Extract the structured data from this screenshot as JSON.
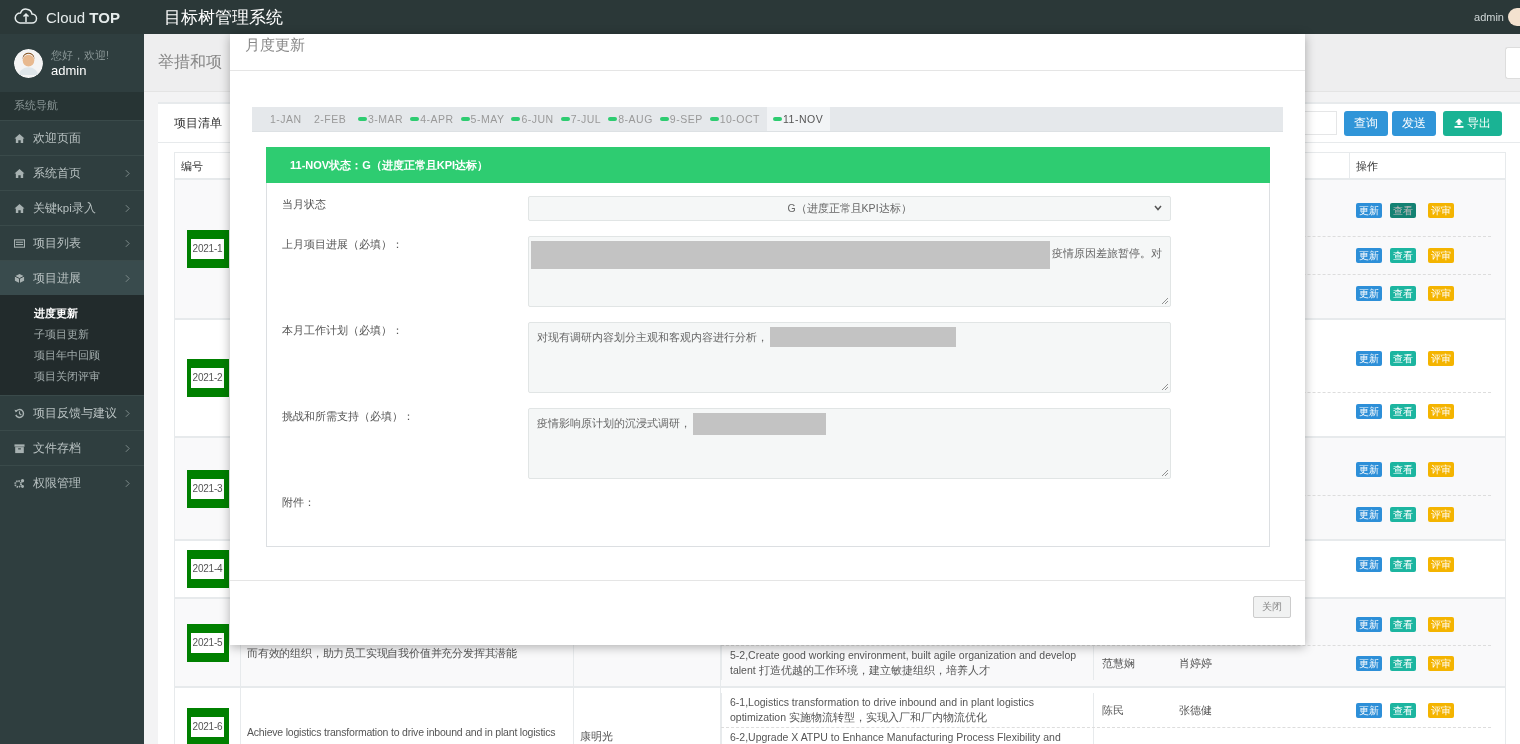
{
  "header": {
    "brand": "Cloud **TOP**",
    "title": "目标树管理系统",
    "user": "admin"
  },
  "sidebar": {
    "greeting": "您好，欢迎!",
    "username": "admin",
    "section_title": "系统导航",
    "items": [
      {
        "label": "欢迎页面",
        "expandable": false,
        "expanded": false
      },
      {
        "label": "系统首页",
        "expandable": true,
        "expanded": false
      },
      {
        "label": "关键kpi录入",
        "expandable": true,
        "expanded": false
      },
      {
        "label": "项目列表",
        "expandable": true,
        "expanded": false
      },
      {
        "label": "项目进展",
        "expandable": true,
        "expanded": true,
        "children": [
          {
            "label": "进度更新",
            "selected": true
          },
          {
            "label": "子项目更新",
            "selected": false
          },
          {
            "label": "项目年中回顾",
            "selected": false
          },
          {
            "label": "项目关闭评审",
            "selected": false
          }
        ]
      },
      {
        "label": "项目反馈与建议",
        "expandable": true,
        "expanded": false
      },
      {
        "label": "文件存档",
        "expandable": true,
        "expanded": false
      },
      {
        "label": "权限管理",
        "expandable": true,
        "expanded": false
      }
    ]
  },
  "page": {
    "title": "举措和项"
  },
  "card": {
    "title": "项目清单",
    "buttons": [
      {
        "label": "查询",
        "kind": "primary"
      },
      {
        "label": "发送",
        "kind": "primary"
      },
      {
        "label": "导出",
        "kind": "export"
      }
    ]
  },
  "table": {
    "id_header": "编号",
    "actions_header": "操作",
    "rows": [
      {
        "id": "2021-1",
        "subrows": [
          {
            "actions": [
              {
                "label": "更新",
                "kind": "update",
                "hovered": false
              },
              {
                "label": "查看",
                "kind": "view",
                "hovered": true
              },
              {
                "label": "评审",
                "kind": "review",
                "hovered": false
              }
            ]
          },
          {
            "actions": [
              {
                "label": "更新",
                "kind": "update",
                "hovered": false
              },
              {
                "label": "查看",
                "kind": "view",
                "hovered": false
              },
              {
                "label": "评审",
                "kind": "review",
                "hovered": false
              }
            ]
          },
          {
            "actions": [
              {
                "label": "更新",
                "kind": "update",
                "hovered": false
              },
              {
                "label": "查看",
                "kind": "view",
                "hovered": false
              },
              {
                "label": "评审",
                "kind": "review",
                "hovered": false
              }
            ]
          }
        ]
      },
      {
        "id": "2021-2",
        "subrows": [
          {
            "actions": [
              {
                "label": "更新",
                "kind": "update",
                "hovered": false
              },
              {
                "label": "查看",
                "kind": "view",
                "hovered": false
              },
              {
                "label": "评审",
                "kind": "review",
                "hovered": false
              }
            ]
          },
          {
            "actions": [
              {
                "label": "更新",
                "kind": "update",
                "hovered": false
              },
              {
                "label": "查看",
                "kind": "view",
                "hovered": false
              },
              {
                "label": "评审",
                "kind": "review",
                "hovered": false
              }
            ]
          }
        ]
      },
      {
        "id": "2021-3",
        "subrows": [
          {
            "actions": [
              {
                "label": "更新",
                "kind": "update",
                "hovered": false
              },
              {
                "label": "查看",
                "kind": "view",
                "hovered": false
              },
              {
                "label": "评审",
                "kind": "review",
                "hovered": false
              }
            ]
          },
          {
            "actions": [
              {
                "label": "更新",
                "kind": "update",
                "hovered": false
              },
              {
                "label": "查看",
                "kind": "view",
                "hovered": false
              },
              {
                "label": "评审",
                "kind": "review",
                "hovered": false
              }
            ]
          }
        ]
      },
      {
        "id": "2021-4",
        "subrows": [
          {
            "actions": [
              {
                "label": "更新",
                "kind": "update",
                "hovered": false
              },
              {
                "label": "查看",
                "kind": "view",
                "hovered": false
              },
              {
                "label": "评审",
                "kind": "review",
                "hovered": false
              }
            ]
          }
        ]
      },
      {
        "id": "2021-5",
        "goal": "而有效的组织，助力员工实现自我价值并充分发挥其潜能",
        "subrows": [
          {
            "actions": [
              {
                "label": "更新",
                "kind": "update",
                "hovered": false
              },
              {
                "label": "查看",
                "kind": "view",
                "hovered": false
              },
              {
                "label": "评审",
                "kind": "review",
                "hovered": false
              }
            ]
          },
          {
            "task": "5-2,Create good working environment, built agile organization and develop talent 打造优越的工作环境，建立敏捷组织，培养人才",
            "lead": "范慧娴",
            "member": "肖婷婷",
            "actions": [
              {
                "label": "更新",
                "kind": "update",
                "hovered": false
              },
              {
                "label": "查看",
                "kind": "view",
                "hovered": false
              },
              {
                "label": "评审",
                "kind": "review",
                "hovered": false
              }
            ]
          }
        ]
      },
      {
        "id": "2021-6",
        "goal": "Achieve logistics transformation to drive inbound and in plant logistics",
        "owner": "康明光",
        "subrows": [
          {
            "task": "6-1,Logistics transformation to drive inbound and in plant logistics optimization 实施物流转型，实现入厂和厂内物流优化",
            "lead": "陈民",
            "member": "张德健",
            "actions": [
              {
                "label": "更新",
                "kind": "update",
                "hovered": false
              },
              {
                "label": "查看",
                "kind": "view",
                "hovered": false
              },
              {
                "label": "评审",
                "kind": "review",
                "hovered": false
              }
            ]
          },
          {
            "task": "6-2,Upgrade X ATPU to Enhance Manufacturing Process Flexibility and"
          }
        ]
      }
    ]
  },
  "modal": {
    "title": "月度更新",
    "months": [
      {
        "label": "1-JAN",
        "filled": false,
        "selected": false
      },
      {
        "label": "2-FEB",
        "filled": false,
        "selected": false
      },
      {
        "label": "3-MAR",
        "filled": true,
        "selected": false
      },
      {
        "label": "4-APR",
        "filled": true,
        "selected": false
      },
      {
        "label": "5-MAY",
        "filled": true,
        "selected": false
      },
      {
        "label": "6-JUN",
        "filled": true,
        "selected": false
      },
      {
        "label": "7-JUL",
        "filled": true,
        "selected": false
      },
      {
        "label": "8-AUG",
        "filled": true,
        "selected": false
      },
      {
        "label": "9-SEP",
        "filled": true,
        "selected": false
      },
      {
        "label": "10-OCT",
        "filled": true,
        "selected": false
      },
      {
        "label": "11-NOV",
        "filled": true,
        "selected": true
      }
    ],
    "status_banner": "11-NOV状态：G（进度正常且KPI达标）",
    "fields": [
      {
        "kind": "select",
        "label": "当月状态",
        "value": "G（进度正常且KPI达标）"
      },
      {
        "kind": "textarea",
        "label": "上月项目进展（必填）：",
        "segments": [
          {
            "kind": "redacted"
          },
          {
            "kind": "text",
            "text": "疫情原因差旅暂停。对"
          }
        ]
      },
      {
        "kind": "textarea",
        "label": "本月工作计划（必填）：",
        "segments": [
          {
            "kind": "text",
            "text": "对现有调研内容划分主观和客观内容进行分析，"
          },
          {
            "kind": "redacted"
          }
        ]
      },
      {
        "kind": "textarea",
        "label": "挑战和所需支持（必填）：",
        "segments": [
          {
            "kind": "text",
            "text": "疫情影响原计划的沉浸式调研，"
          },
          {
            "kind": "redacted"
          }
        ]
      },
      {
        "kind": "attachment",
        "label": "附件："
      }
    ],
    "close_button": "关闭"
  }
}
